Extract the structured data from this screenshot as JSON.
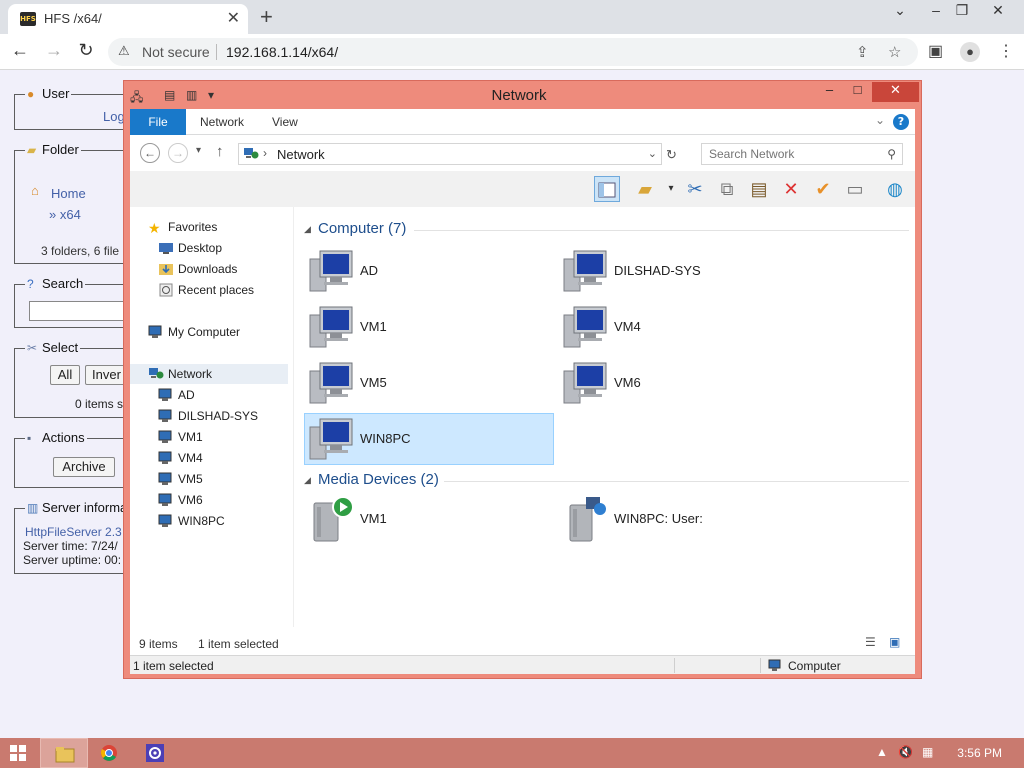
{
  "browser": {
    "tab_title": "HFS /x64/",
    "security_label": "Not secure",
    "url": "192.168.1.14/x64/"
  },
  "hfs": {
    "user_legend": "User",
    "login_link": "Log",
    "folder_legend": "Folder",
    "home_link": "Home",
    "current_folder": "» x64",
    "folder_stats": "3 folders, 6 file",
    "search_legend": "Search",
    "select_legend": "Select",
    "select_all": "All",
    "select_invert": "Inver",
    "items_selected": "0 items s",
    "actions_legend": "Actions",
    "archive_button": "Archive",
    "server_legend": "Server informa",
    "server_software": "HttpFileServer 2.3",
    "server_time": "Server time: 7/24/",
    "server_uptime": "Server uptime: 00:"
  },
  "explorer": {
    "title": "Network",
    "ribbon_tabs": [
      "File",
      "Network",
      "View"
    ],
    "address": "Network",
    "search_placeholder": "Search Network",
    "nav": {
      "favorites": "Favorites",
      "desktop": "Desktop",
      "downloads": "Downloads",
      "recent": "Recent places",
      "my_computer": "My Computer",
      "network": "Network",
      "hosts": [
        "AD",
        "DILSHAD-SYS",
        "VM1",
        "VM4",
        "VM5",
        "VM6",
        "WIN8PC"
      ]
    },
    "groups": {
      "computer_header": "Computer (7)",
      "media_header": "Media Devices (2)"
    },
    "computers": [
      "AD",
      "DILSHAD-SYS",
      "VM1",
      "VM4",
      "VM5",
      "VM6",
      "WIN8PC"
    ],
    "media": [
      "VM1",
      "WIN8PC: User:"
    ],
    "item_count": "9 items",
    "selection_count": "1 item selected",
    "status_left": "1 item selected",
    "status_zone": "Computer"
  },
  "taskbar": {
    "clock": "3:56 PM"
  }
}
